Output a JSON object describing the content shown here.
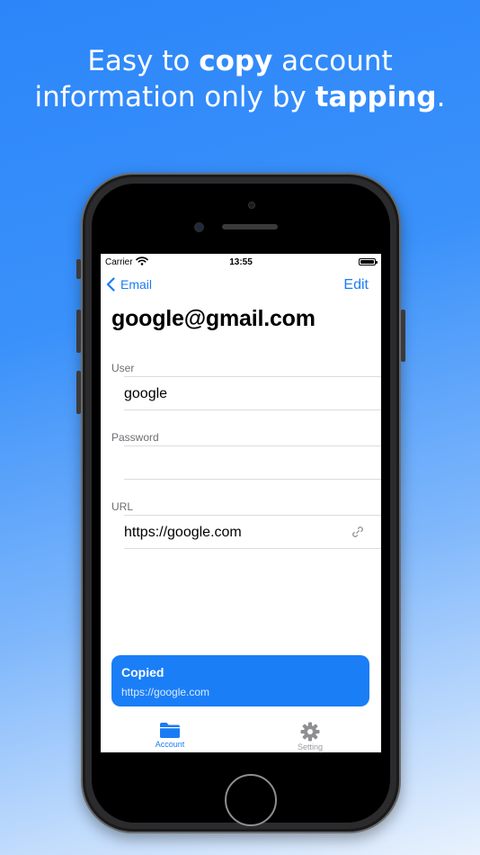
{
  "headline": {
    "line1_pre": "Easy to ",
    "line1_bold": "copy",
    "line1_post": " account",
    "line2_pre": "information only by ",
    "line2_bold": "tapping",
    "line2_post": "."
  },
  "status_bar": {
    "carrier": "Carrier",
    "time": "13:55"
  },
  "nav": {
    "back_label": "Email",
    "edit_label": "Edit"
  },
  "account": {
    "title": "google@gmail.com",
    "fields": [
      {
        "label": "User",
        "value": "google"
      },
      {
        "label": "Password",
        "value": ""
      },
      {
        "label": "URL",
        "value": "https://google.com"
      }
    ]
  },
  "toast": {
    "title": "Copied",
    "subtitle": "https://google.com"
  },
  "tabbar": {
    "items": [
      {
        "label": "Account",
        "icon": "folder-icon",
        "active": true
      },
      {
        "label": "Setting",
        "icon": "gear-icon",
        "active": false
      }
    ]
  },
  "colors": {
    "accent": "#1a7cf5",
    "toast": "#1a7ef7",
    "background_top": "#2c86f9",
    "background_bottom": "#e9f2fd"
  }
}
